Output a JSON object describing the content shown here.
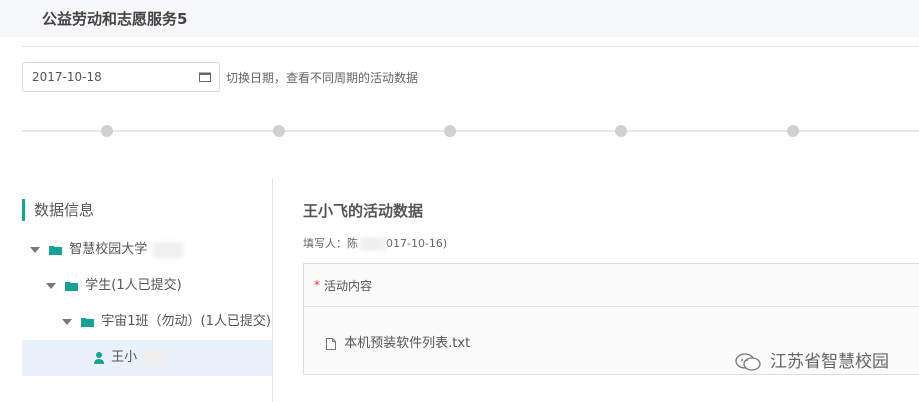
{
  "page": {
    "title": "公益劳动和志愿服务5"
  },
  "date_picker": {
    "value": "2017-10-18",
    "hint": "切换日期，查看不同周期的活动数据"
  },
  "sidebar": {
    "title": "数据信息",
    "tree": [
      {
        "label": "智慧校园大学",
        "level": 0,
        "icon": "folder-icon",
        "expanded": true
      },
      {
        "label": "学生(1人已提交)",
        "level": 1,
        "icon": "folder-icon",
        "expanded": true
      },
      {
        "label": "宇宙1班（勿动）(1人已提交)",
        "level": 2,
        "icon": "folder-icon",
        "expanded": true
      },
      {
        "label": "王小",
        "level": 3,
        "icon": "user-icon",
        "selected": true
      }
    ]
  },
  "content": {
    "title": "王小飞的活动数据",
    "filler_prefix": "填写人：陈",
    "filler_suffix": "017-10-16)",
    "panel": {
      "required_mark": "*",
      "label": "活动内容",
      "file_name": "本机预装软件列表.txt"
    }
  },
  "watermark": {
    "text": "江苏省智慧校园"
  },
  "colors": {
    "accent": "#1aa094",
    "required": "#e03131",
    "selected_row": "#e9f2fb",
    "folder": "#1aa094"
  }
}
